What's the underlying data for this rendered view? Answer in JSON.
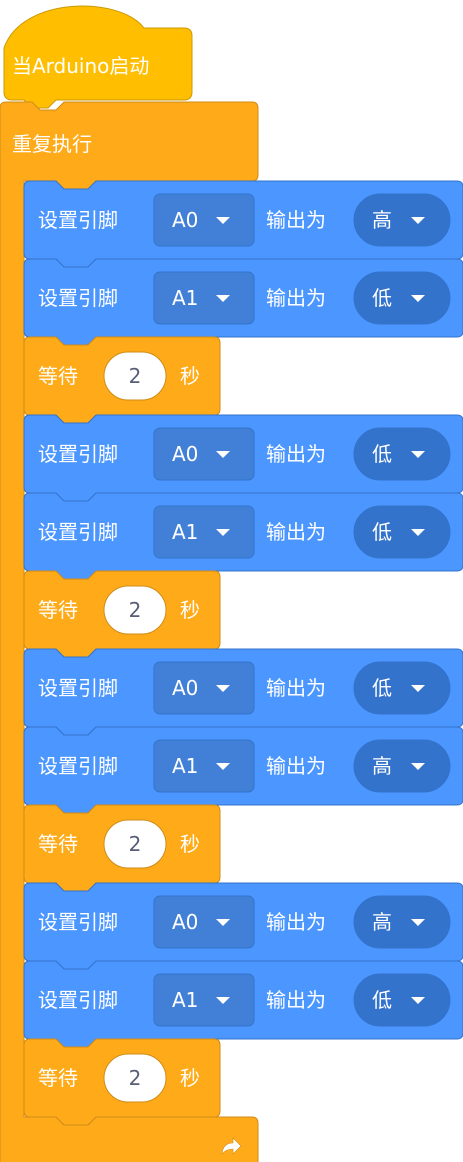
{
  "colors": {
    "hat_fill": "#ffbf00",
    "hat_stroke": "#cc9900",
    "loop_fill": "#ffab19",
    "loop_stroke": "#cf8b17",
    "pin_fill": "#4c97ff",
    "pin_stroke": "#3373cc",
    "pin_field_fill": "#4280d7",
    "level_field_fill": "#3373cc",
    "wait_input_fill": "#ffffff",
    "wait_input_text": "#575e75"
  },
  "hat": {
    "label": "当Arduino启动"
  },
  "loop": {
    "label": "重复执行",
    "loop_icon": "loop-arrow-icon"
  },
  "blocks": [
    {
      "type": "set_pin",
      "prefix": "设置引脚",
      "pin": "A0",
      "middle": "输出为",
      "level": "高"
    },
    {
      "type": "set_pin",
      "prefix": "设置引脚",
      "pin": "A1",
      "middle": "输出为",
      "level": "低"
    },
    {
      "type": "wait",
      "prefix": "等待",
      "value": "2",
      "suffix": "秒"
    },
    {
      "type": "set_pin",
      "prefix": "设置引脚",
      "pin": "A0",
      "middle": "输出为",
      "level": "低"
    },
    {
      "type": "set_pin",
      "prefix": "设置引脚",
      "pin": "A1",
      "middle": "输出为",
      "level": "低"
    },
    {
      "type": "wait",
      "prefix": "等待",
      "value": "2",
      "suffix": "秒"
    },
    {
      "type": "set_pin",
      "prefix": "设置引脚",
      "pin": "A0",
      "middle": "输出为",
      "level": "低"
    },
    {
      "type": "set_pin",
      "prefix": "设置引脚",
      "pin": "A1",
      "middle": "输出为",
      "level": "高"
    },
    {
      "type": "wait",
      "prefix": "等待",
      "value": "2",
      "suffix": "秒"
    },
    {
      "type": "set_pin",
      "prefix": "设置引脚",
      "pin": "A0",
      "middle": "输出为",
      "level": "高"
    },
    {
      "type": "set_pin",
      "prefix": "设置引脚",
      "pin": "A1",
      "middle": "输出为",
      "level": "低"
    },
    {
      "type": "wait",
      "prefix": "等待",
      "value": "2",
      "suffix": "秒"
    }
  ]
}
